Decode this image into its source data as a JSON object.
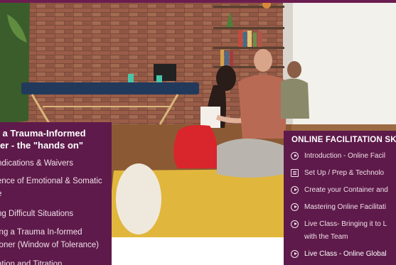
{
  "left_panel": {
    "title": "g a Trauma-Informed\nner - the \"hands on\"",
    "items": [
      "ndications & Waivers",
      "ence of Emotional & Somatic",
      "e",
      "ng Difficult Situations",
      "ing a Trauma In-formed",
      "ioner (Window of Tolerance)",
      "ation and Titration"
    ]
  },
  "right_panel": {
    "title": "ONLINE FACILITATION SK",
    "items": [
      {
        "label": "Introduction - Online Facil",
        "icon": "play-circle-icon"
      },
      {
        "label": "Set Up / Prep & Technolo",
        "icon": "document-icon"
      },
      {
        "label": "Create your Container and",
        "icon": "play-circle-icon"
      },
      {
        "label": "Mastering Online Facilitati",
        "icon": "play-circle-icon"
      },
      {
        "label": "Live Class- Bringing it to L",
        "icon": "play-circle-icon"
      },
      {
        "label": "with the Team",
        "icon": ""
      },
      {
        "label": "Live Class - Online Global",
        "icon": "play-circle-icon"
      }
    ]
  },
  "colors": {
    "panel_bg": "#5e1a4a",
    "accent": "#6b1d4f",
    "mat": "#e1b63c",
    "shirt": "#b96a55",
    "pants_red": "#d8262c"
  }
}
